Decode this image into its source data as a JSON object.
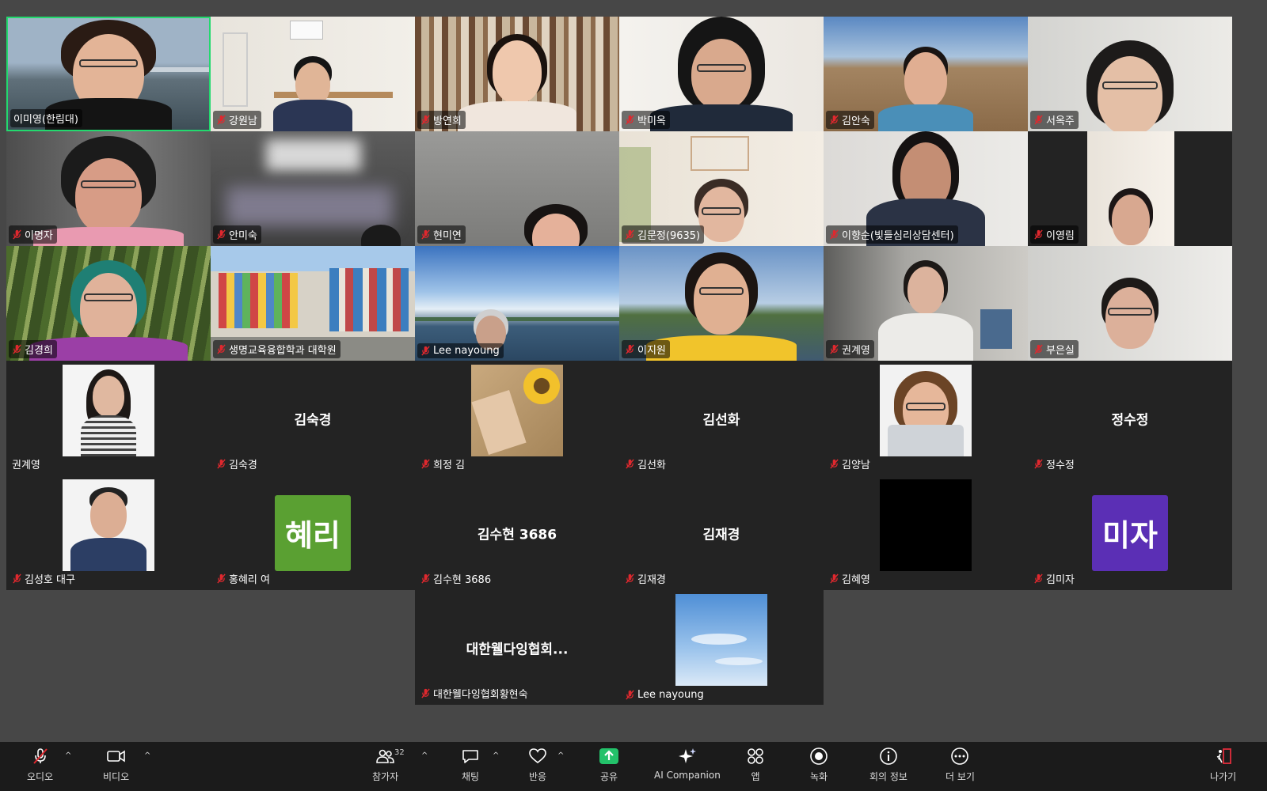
{
  "participants_grid": {
    "row1": [
      {
        "name": "이미영(한림대)",
        "muted": false
      },
      {
        "name": "강원남",
        "muted": true
      },
      {
        "name": "방연희",
        "muted": true
      },
      {
        "name": "박미옥",
        "muted": true
      },
      {
        "name": "김안숙",
        "muted": true
      },
      {
        "name": "서옥주",
        "muted": true
      }
    ],
    "row2": [
      {
        "name": "이명자",
        "muted": true
      },
      {
        "name": "안미숙",
        "muted": true
      },
      {
        "name": "현미연",
        "muted": true
      },
      {
        "name": "김문정(9635)",
        "muted": true
      },
      {
        "name": "이향순(빛들심리상담센터)",
        "muted": true
      },
      {
        "name": "이영림",
        "muted": true
      }
    ],
    "row3": [
      {
        "name": "김경희",
        "muted": true
      },
      {
        "name": "생명교육융합학과 대학원",
        "muted": true
      },
      {
        "name": "Lee nayoung",
        "muted": true
      },
      {
        "name": "이지원",
        "muted": true
      },
      {
        "name": "권계영",
        "muted": true
      },
      {
        "name": "부은실",
        "muted": true
      }
    ],
    "row4": [
      {
        "name": "권계영",
        "muted": false,
        "center": ""
      },
      {
        "name": "김숙경",
        "muted": true,
        "center": "김숙경"
      },
      {
        "name": "희정 김",
        "muted": true,
        "center": ""
      },
      {
        "name": "김선화",
        "muted": true,
        "center": "김선화"
      },
      {
        "name": "김양남",
        "muted": true,
        "center": ""
      },
      {
        "name": "정수정",
        "muted": true,
        "center": "정수정"
      }
    ],
    "row5": [
      {
        "name": "김성호 대구",
        "muted": true,
        "center": ""
      },
      {
        "name": "홍혜리 여",
        "muted": true,
        "center": "",
        "initials": "혜리",
        "initials_color": "#5aa032"
      },
      {
        "name": "김수현 3686",
        "muted": true,
        "center": "김수현 3686"
      },
      {
        "name": "김재경",
        "muted": true,
        "center": "김재경"
      },
      {
        "name": "김혜영",
        "muted": true,
        "center": ""
      },
      {
        "name": "김미자",
        "muted": true,
        "center": "",
        "initials": "미자",
        "initials_color": "#5b2fb5"
      }
    ],
    "row6": [
      {
        "name": "대한웰다잉협회황현숙",
        "muted": true,
        "center": "대한웰다잉협회..."
      },
      {
        "name": "Lee nayoung",
        "muted": true,
        "center": ""
      }
    ]
  },
  "toolbar": {
    "audio": "오디오",
    "video": "비디오",
    "participants": "참가자",
    "participants_count": "32",
    "chat": "채팅",
    "reactions": "반응",
    "share": "공유",
    "ai_companion": "AI Companion",
    "apps": "앱",
    "record": "녹화",
    "meeting_info": "회의 정보",
    "more": "더 보기",
    "leave": "나가기"
  },
  "colors": {
    "active_speaker": "#23d96e",
    "share_button": "#23c26a",
    "leave": "#e02d3c",
    "muted_icon": "#e0282e"
  }
}
